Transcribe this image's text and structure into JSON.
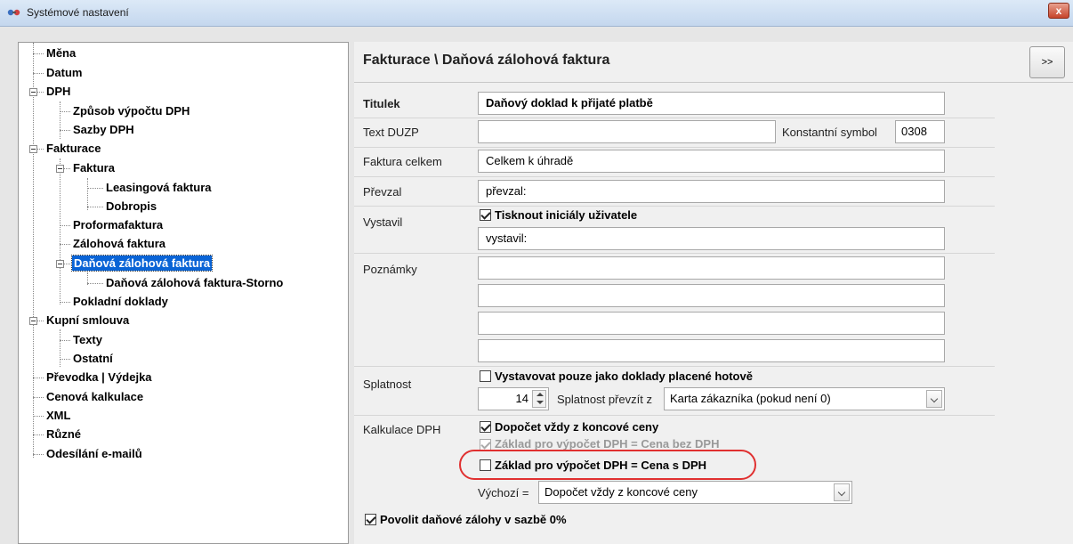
{
  "window": {
    "title": "Systémové nastavení",
    "close_label": "x"
  },
  "tree": {
    "items": [
      {
        "label": "Měna"
      },
      {
        "label": "Datum"
      },
      {
        "label": "DPH"
      },
      {
        "label": "Způsob výpočtu DPH"
      },
      {
        "label": "Sazby DPH"
      },
      {
        "label": "Fakturace"
      },
      {
        "label": "Faktura"
      },
      {
        "label": "Leasingová faktura"
      },
      {
        "label": "Dobropis"
      },
      {
        "label": "Proformafaktura"
      },
      {
        "label": "Zálohová faktura"
      },
      {
        "label": "Daňová zálohová faktura"
      },
      {
        "label": "Daňová zálohová faktura-Storno"
      },
      {
        "label": "Pokladní doklady"
      },
      {
        "label": "Kupní smlouva"
      },
      {
        "label": "Texty"
      },
      {
        "label": "Ostatní"
      },
      {
        "label": "Převodka | Výdejka"
      },
      {
        "label": "Cenová kalkulace"
      },
      {
        "label": "XML"
      },
      {
        "label": "Různé"
      },
      {
        "label": "Odesílání e-mailů"
      }
    ]
  },
  "panel": {
    "title": "Fakturace \\ Daňová zálohová faktura",
    "nav_button": ">>",
    "titulek": {
      "label": "Titulek",
      "value": "Daňový doklad k přijaté platbě"
    },
    "text_duzp": {
      "label": "Text DUZP",
      "value": ""
    },
    "konst_symbol": {
      "label": "Konstantní symbol",
      "value": "0308"
    },
    "faktura_celkem": {
      "label": "Faktura celkem",
      "value": "Celkem k úhradě"
    },
    "prevzal": {
      "label": "Převzal",
      "value": "převzal:"
    },
    "vystavil": {
      "label": "Vystavil",
      "checkbox_label": "Tisknout iniciály uživatele",
      "value": "vystavil:"
    },
    "poznamky": {
      "label": "Poznámky",
      "lines": [
        "",
        "",
        "",
        ""
      ]
    },
    "splatnost": {
      "label": "Splatnost",
      "checkbox_label": "Vystavovat pouze jako doklady placené hotově",
      "days": "14",
      "prevzit_label": "Splatnost převzít z",
      "prevzit_value": "Karta zákazníka (pokud není 0)"
    },
    "kalkulace": {
      "label": "Kalkulace DPH",
      "opt1": "Dopočet vždy z koncové ceny",
      "opt2": "Základ pro výpočet DPH = Cena bez DPH",
      "opt3": "Základ pro výpočet DPH = Cena s DPH",
      "vychozi_label": "Výchozí =",
      "vychozi_value": "Dopočet vždy z koncové ceny"
    },
    "povolit": "Povolit daňové zálohy v sazbě 0%"
  },
  "colors": {
    "selection": "#0a64d6",
    "annotation": "#e03030"
  }
}
